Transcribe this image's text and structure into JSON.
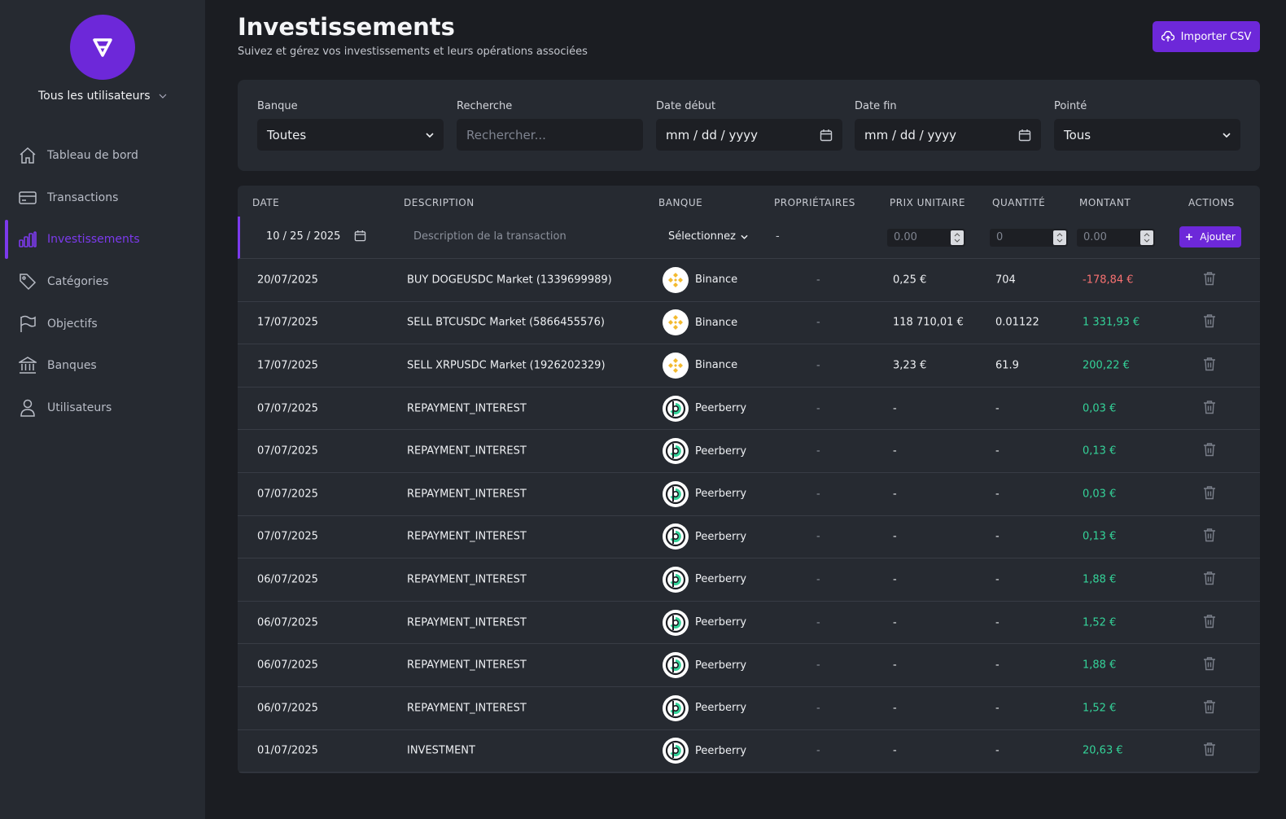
{
  "sidebar": {
    "user_select": "Tous les utilisateurs",
    "items": [
      {
        "label": "Tableau de bord",
        "icon": "home-icon"
      },
      {
        "label": "Transactions",
        "icon": "credit-card-icon"
      },
      {
        "label": "Investissements",
        "icon": "bar-chart-icon",
        "active": true
      },
      {
        "label": "Catégories",
        "icon": "tag-icon"
      },
      {
        "label": "Objectifs",
        "icon": "flag-icon"
      },
      {
        "label": "Banques",
        "icon": "bank-icon"
      },
      {
        "label": "Utilisateurs",
        "icon": "user-icon"
      }
    ]
  },
  "header": {
    "title": "Investissements",
    "subtitle": "Suivez et gérez vos investissements et leurs opérations associées",
    "import_label": "Importer CSV"
  },
  "filters": {
    "bank": {
      "label": "Banque",
      "value": "Toutes"
    },
    "search": {
      "label": "Recherche",
      "placeholder": "Rechercher..."
    },
    "start": {
      "label": "Date début",
      "value": "mm / dd / yyyy"
    },
    "end": {
      "label": "Date fin",
      "value": "mm / dd / yyyy"
    },
    "checked": {
      "label": "Pointé",
      "value": "Tous"
    }
  },
  "table": {
    "headers": {
      "date": "Date",
      "description": "Description",
      "bank": "Banque",
      "owners": "Propriétaires",
      "unit_price": "Prix unitaire",
      "quantity": "Quantité",
      "amount": "Montant",
      "actions": "Actions"
    },
    "new_row": {
      "date": "10 / 25 / 2025",
      "description_placeholder": "Description de la transaction",
      "bank_select": "Sélectionnez",
      "owners": "-",
      "unit_price": "0.00",
      "quantity": "0",
      "amount": "0.00",
      "add_label": "Ajouter"
    },
    "rows": [
      {
        "date": "20/07/2025",
        "description": "BUY DOGEUSDC Market (1339699989)",
        "bank": "Binance",
        "owners": "-",
        "price": "0,25 €",
        "qty": "704",
        "amount": "-178,84 €",
        "sign": "neg"
      },
      {
        "date": "17/07/2025",
        "description": "SELL BTCUSDC Market (5866455576)",
        "bank": "Binance",
        "owners": "-",
        "price": "118 710,01 €",
        "qty": "0.01122",
        "amount": "1 331,93 €",
        "sign": "pos"
      },
      {
        "date": "17/07/2025",
        "description": "SELL XRPUSDC Market (1926202329)",
        "bank": "Binance",
        "owners": "-",
        "price": "3,23 €",
        "qty": "61.9",
        "amount": "200,22 €",
        "sign": "pos"
      },
      {
        "date": "07/07/2025",
        "description": "REPAYMENT_INTEREST",
        "bank": "Peerberry",
        "owners": "-",
        "price": "-",
        "qty": "-",
        "amount": "0,03 €",
        "sign": "pos"
      },
      {
        "date": "07/07/2025",
        "description": "REPAYMENT_INTEREST",
        "bank": "Peerberry",
        "owners": "-",
        "price": "-",
        "qty": "-",
        "amount": "0,13 €",
        "sign": "pos"
      },
      {
        "date": "07/07/2025",
        "description": "REPAYMENT_INTEREST",
        "bank": "Peerberry",
        "owners": "-",
        "price": "-",
        "qty": "-",
        "amount": "0,03 €",
        "sign": "pos"
      },
      {
        "date": "07/07/2025",
        "description": "REPAYMENT_INTEREST",
        "bank": "Peerberry",
        "owners": "-",
        "price": "-",
        "qty": "-",
        "amount": "0,13 €",
        "sign": "pos"
      },
      {
        "date": "06/07/2025",
        "description": "REPAYMENT_INTEREST",
        "bank": "Peerberry",
        "owners": "-",
        "price": "-",
        "qty": "-",
        "amount": "1,88 €",
        "sign": "pos"
      },
      {
        "date": "06/07/2025",
        "description": "REPAYMENT_INTEREST",
        "bank": "Peerberry",
        "owners": "-",
        "price": "-",
        "qty": "-",
        "amount": "1,52 €",
        "sign": "pos"
      },
      {
        "date": "06/07/2025",
        "description": "REPAYMENT_INTEREST",
        "bank": "Peerberry",
        "owners": "-",
        "price": "-",
        "qty": "-",
        "amount": "1,88 €",
        "sign": "pos"
      },
      {
        "date": "06/07/2025",
        "description": "REPAYMENT_INTEREST",
        "bank": "Peerberry",
        "owners": "-",
        "price": "-",
        "qty": "-",
        "amount": "1,52 €",
        "sign": "pos"
      },
      {
        "date": "01/07/2025",
        "description": "INVESTMENT",
        "bank": "Peerberry",
        "owners": "-",
        "price": "-",
        "qty": "-",
        "amount": "20,63 €",
        "sign": "pos"
      }
    ]
  },
  "colors": {
    "accent": "#7c3aed",
    "positive": "#34d399",
    "negative": "#f87171",
    "binance": "#f3ba2f",
    "peerberry": "#34d399"
  }
}
